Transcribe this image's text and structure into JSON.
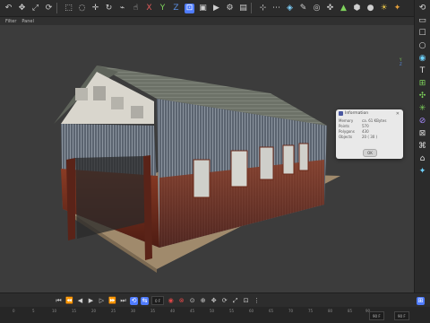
{
  "menubar": {
    "items": [
      "Filter",
      "Panel"
    ]
  },
  "toolbar": {
    "x_label": "X",
    "y_label": "Y",
    "z_label": "Z"
  },
  "axis": {
    "y": "Y",
    "z": "Z"
  },
  "dialog": {
    "title": "Information",
    "rows": [
      {
        "key": "Memory",
        "value": "ca. 61 KBytes"
      },
      {
        "key": "Points",
        "value": "570"
      },
      {
        "key": "Polygons",
        "value": "430"
      },
      {
        "key": "Objects",
        "value": "20 ( 30 )"
      }
    ],
    "ok_label": "OK"
  },
  "timeline": {
    "frame_field": "0 F",
    "end_field_a": "90 F",
    "end_field_b": "90 F"
  },
  "ruler": {
    "ticks": [
      "0",
      "5",
      "10",
      "15",
      "20",
      "25",
      "30",
      "35",
      "40",
      "45",
      "50",
      "55",
      "60",
      "65",
      "70",
      "75",
      "80",
      "85",
      "90"
    ]
  },
  "colors": {
    "accent": "#4f7cff",
    "ui_dark": "#2b2b2b",
    "viewport": "#3c3c3c",
    "wall_rust": "#6e2a1c",
    "roof": "#757a70"
  }
}
